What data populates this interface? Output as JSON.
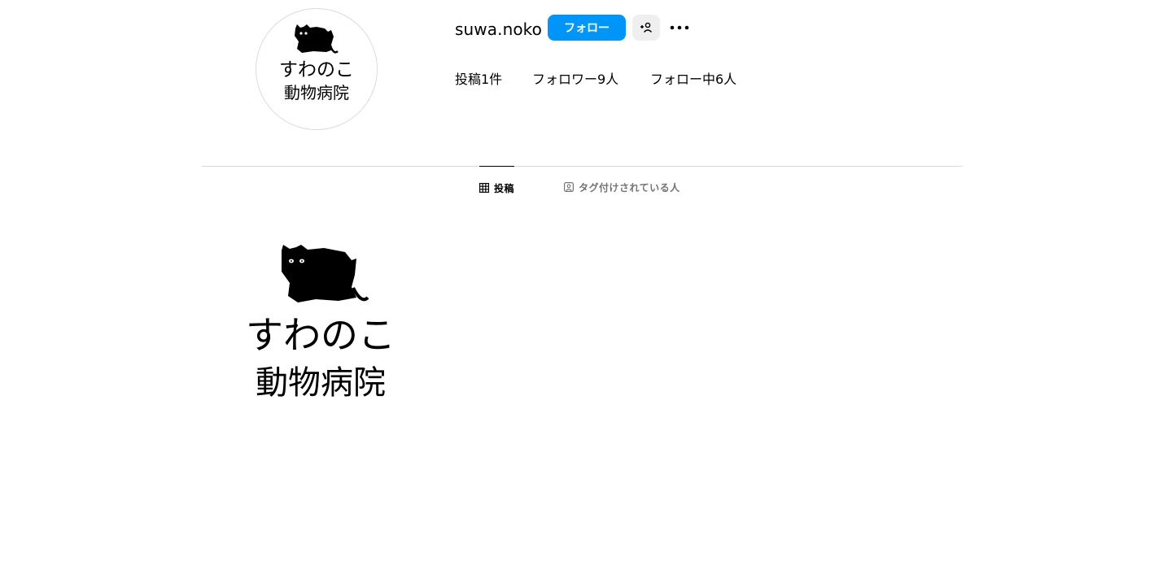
{
  "profile": {
    "username": "suwa.noko",
    "follow_label": "フォロー",
    "suggest_icon": "person-add-icon",
    "more_icon": "more-horizontal-icon",
    "avatar": {
      "line1": "すわのこ",
      "line2": "動物病院",
      "icon": "black-cat-logo"
    },
    "stats": {
      "posts": "投稿1件",
      "followers": "フォロワー9人",
      "following": "フォロー中6人"
    }
  },
  "tabs": [
    {
      "label": "投稿",
      "icon": "grid-icon",
      "active": true
    },
    {
      "label": "タグ付けされている人",
      "icon": "tagged-person-icon",
      "active": false
    }
  ],
  "posts": [
    {
      "line1": "すわのこ",
      "line2": "動物病院",
      "icon": "black-cat-logo"
    }
  ],
  "colors": {
    "accent": "#0095f6",
    "secondary_button": "#efefef",
    "divider": "#dbdbdb",
    "muted_text": "#737373",
    "text": "#000000"
  }
}
